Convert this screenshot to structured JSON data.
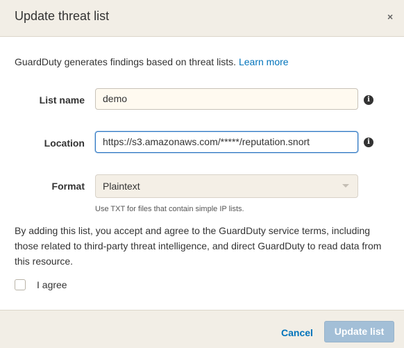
{
  "dialog": {
    "title": "Update threat list",
    "close_icon": "×"
  },
  "intro": {
    "text": "GuardDuty generates findings based on threat lists. ",
    "link": "Learn more"
  },
  "form": {
    "list_name": {
      "label": "List name",
      "value": "demo",
      "info_icon": "i"
    },
    "location": {
      "label": "Location",
      "value": "https://s3.amazonaws.com/*****/reputation.snort",
      "info_icon": "i"
    },
    "format": {
      "label": "Format",
      "value": "Plaintext",
      "hint": "Use TXT for files that contain simple IP lists."
    }
  },
  "terms": "By adding this list, you accept and agree to the GuardDuty service terms, including those related to third-party threat intelligence, and direct GuardDuty to read data from this resource.",
  "agree": {
    "label": "I agree",
    "checked": false
  },
  "footer": {
    "cancel_label": "Cancel",
    "update_label": "Update list",
    "update_enabled": false
  },
  "colors": {
    "header_bg": "#f2eee6",
    "link": "#0073bb",
    "primary_disabled": "#a3bfd7",
    "focus": "#2f78c4"
  }
}
